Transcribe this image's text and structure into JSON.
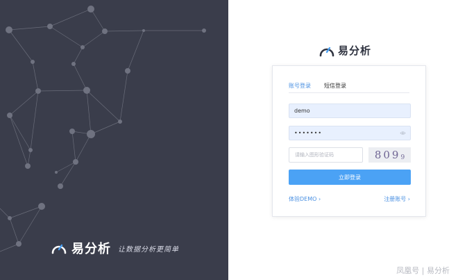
{
  "brand": {
    "name": "易分析",
    "slogan": "让数据分析更简单"
  },
  "login": {
    "tabs": [
      {
        "label": "账号登录",
        "active": true
      },
      {
        "label": "短信登录",
        "active": false
      }
    ],
    "username_value": "demo",
    "password_mask": "•••••••",
    "captcha_placeholder": "请输入图形验证码",
    "captcha_code_main": "809",
    "captcha_code_small": "9",
    "submit_label": "立即登录",
    "demo_link": "体验DEMO",
    "register_link": "注册账号"
  },
  "watermark": "凤凰号 | 易分析",
  "colors": {
    "left_panel": "#3a3d4b",
    "accent": "#4ba2f5",
    "input_fill": "#e8f0fe"
  },
  "icons": [
    "gauge-logo-icon",
    "eye-icon",
    "chevron-right-icon"
  ]
}
